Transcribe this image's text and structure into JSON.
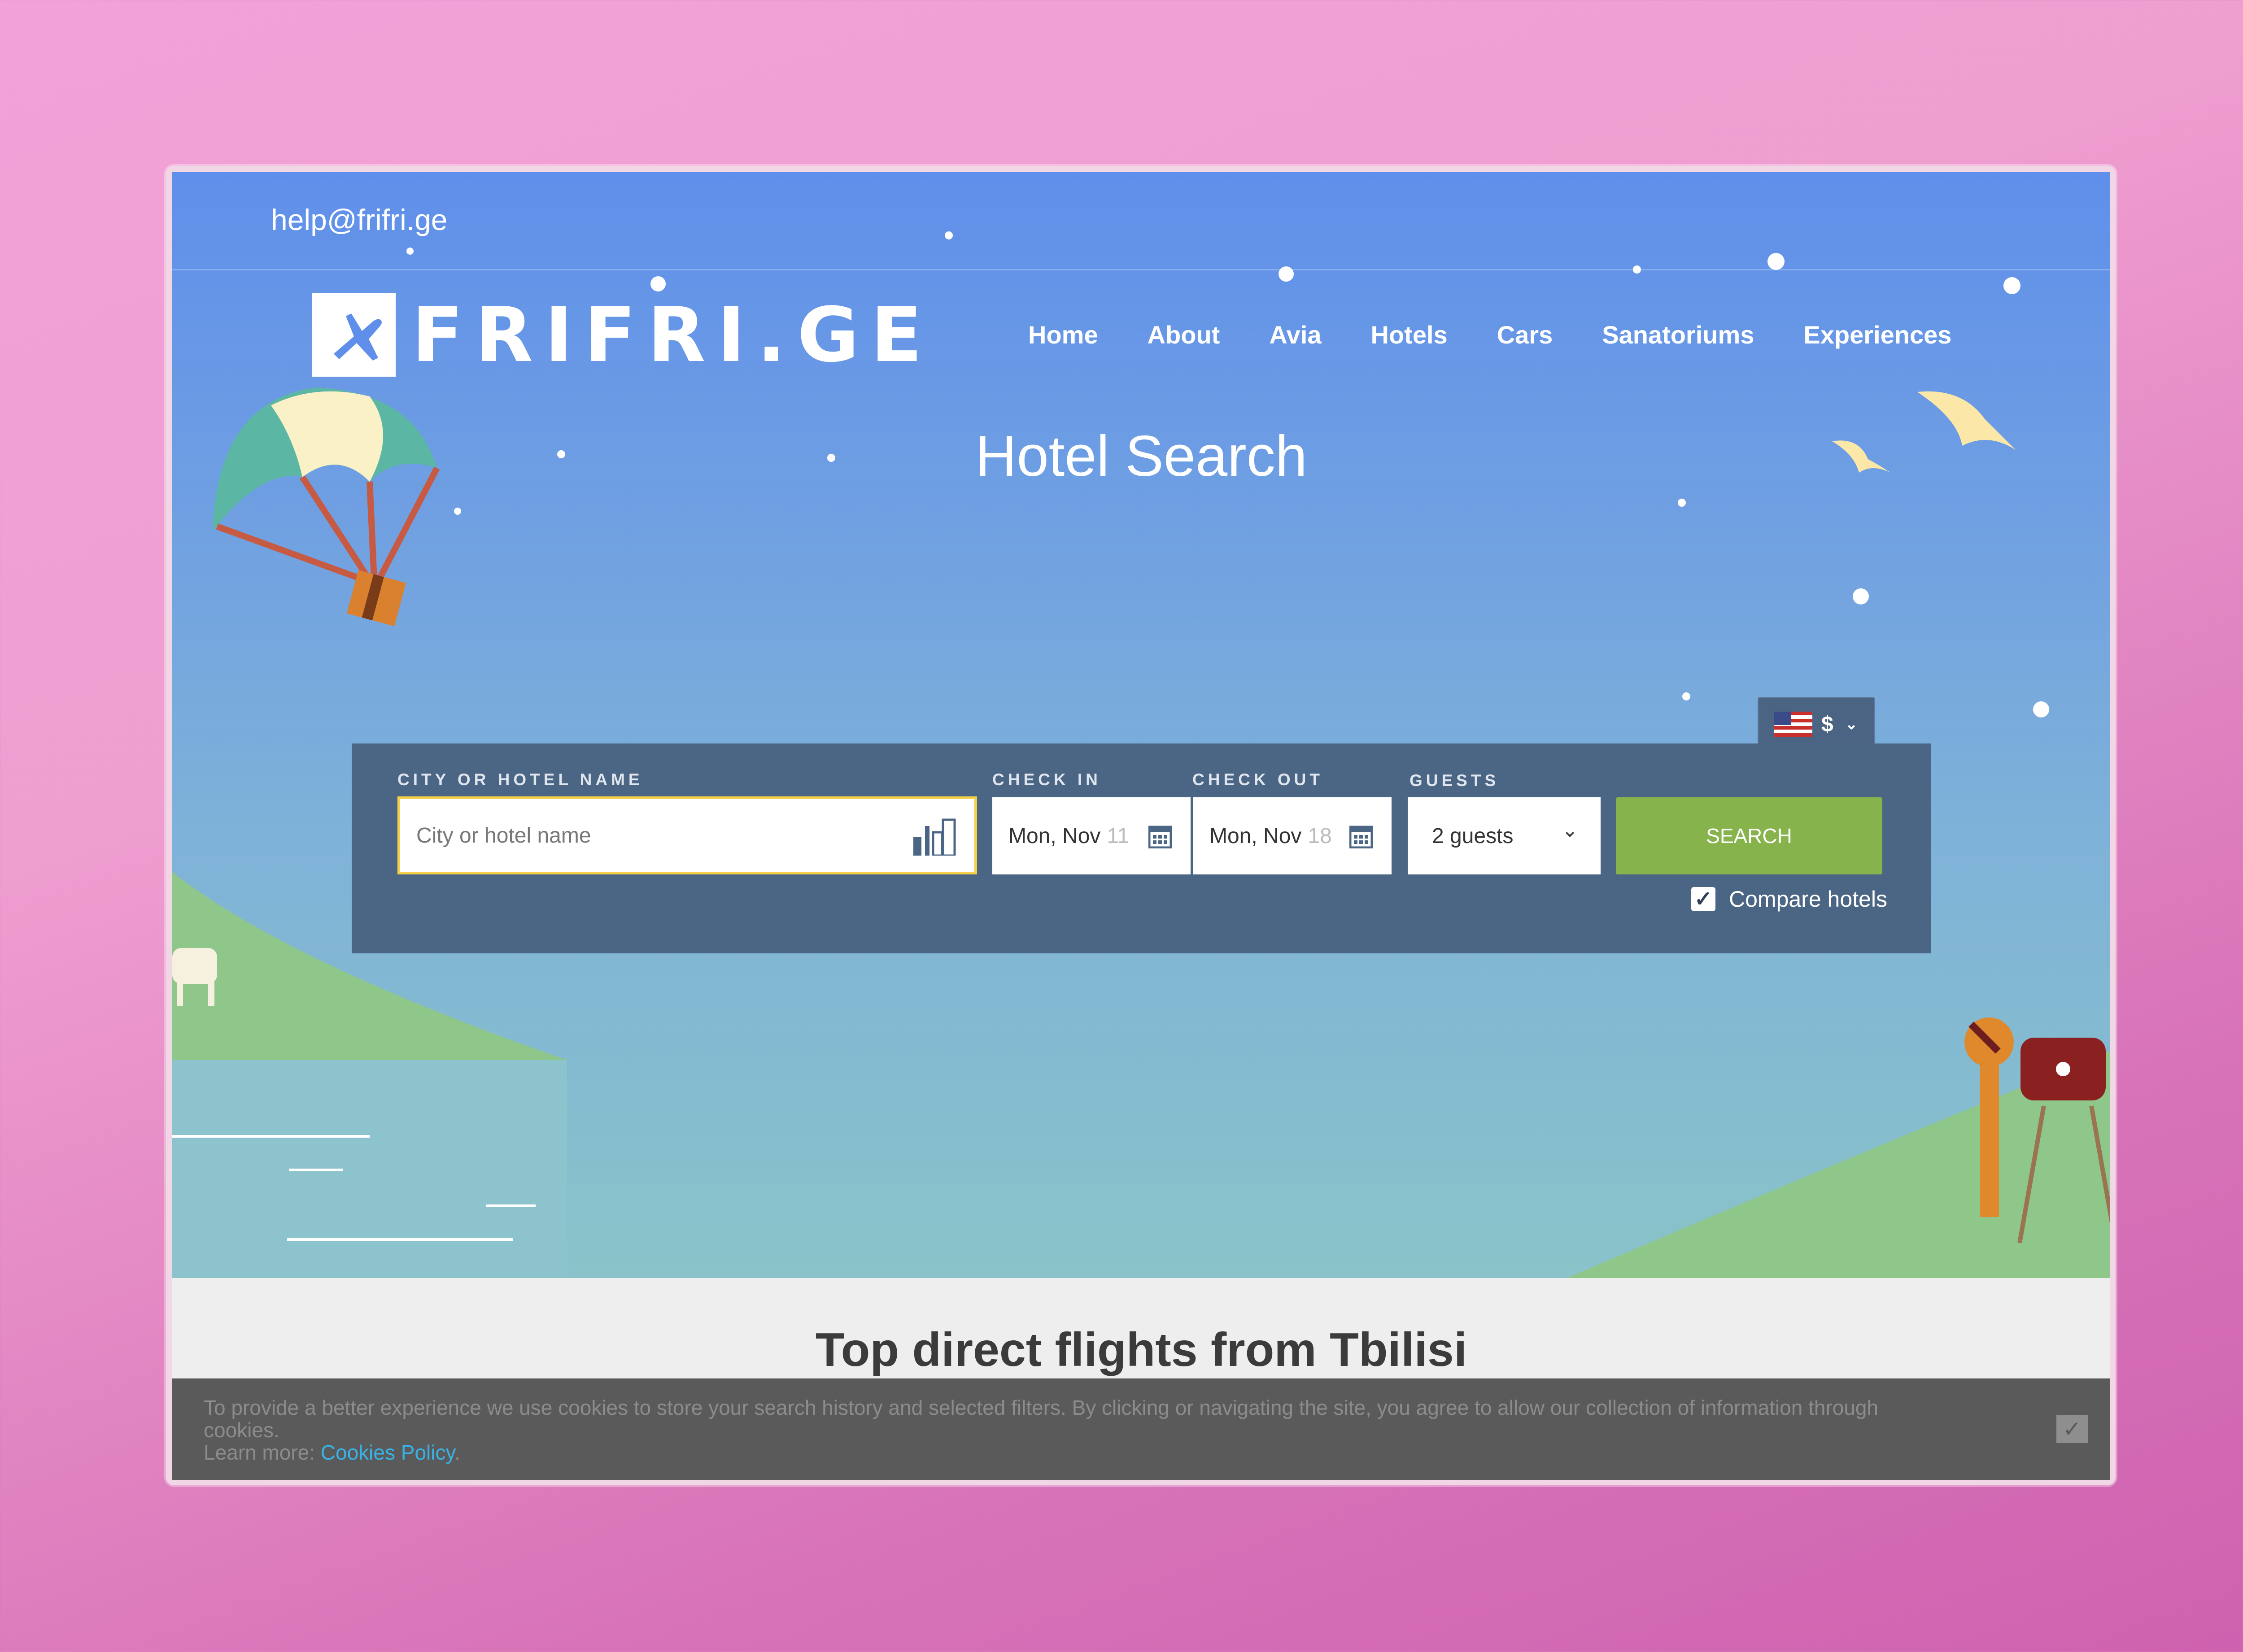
{
  "topbar": {
    "email": "help@frifri.ge"
  },
  "brand": {
    "logo_text": "FRIFRI.GE"
  },
  "nav": {
    "items": [
      "Home",
      "About",
      "Avia",
      "Hotels",
      "Cars",
      "Sanatoriums",
      "Experiences"
    ]
  },
  "hero": {
    "title": "Hotel Search"
  },
  "currency": {
    "symbol": "$"
  },
  "search": {
    "city_label": "CITY OR HOTEL NAME",
    "city_placeholder": "City or hotel name",
    "checkin_label": "CHECK IN",
    "checkin_value": "Mon, Nov",
    "checkin_day": "11",
    "checkout_label": "CHECK OUT",
    "checkout_value": "Mon, Nov",
    "checkout_day": "18",
    "guests_label": "GUESTS",
    "guests_value": "2 guests",
    "button_label": "SEARCH",
    "compare_label": "Compare hotels",
    "compare_checked": true
  },
  "section": {
    "title": "Top direct flights from Tbilisi"
  },
  "cookie": {
    "text": "To provide a better experience we use cookies to store your search history and selected filters. By clicking or navigating the site, you agree to allow our collection of information through cookies.",
    "learn_more": "Learn more:",
    "link": "Cookies Policy",
    "close": "✓"
  },
  "colors": {
    "hero_top": "#5f8fea",
    "search_panel": "#4b6584",
    "search_button": "#86b34b",
    "city_border": "#f4d04b",
    "cookie_bg": "#5a5a5a",
    "link": "#39b3e6"
  }
}
